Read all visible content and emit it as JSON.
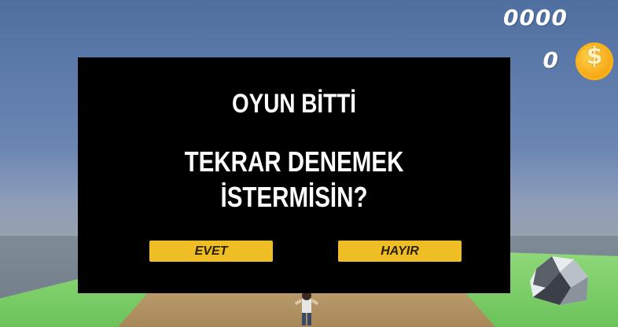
{
  "hud": {
    "score": "0000",
    "coins": "0",
    "coin_symbol": "$"
  },
  "dialog": {
    "title": "OYUN BİTTİ",
    "question_line1": "TEKRAR DENEMEK",
    "question_line2": "İSTERMİSİN?",
    "yes_label": "EVET",
    "no_label": "HAYIR"
  },
  "colors": {
    "panel": "#000000",
    "button": "#efbe25",
    "coin": "#f5a20f"
  }
}
